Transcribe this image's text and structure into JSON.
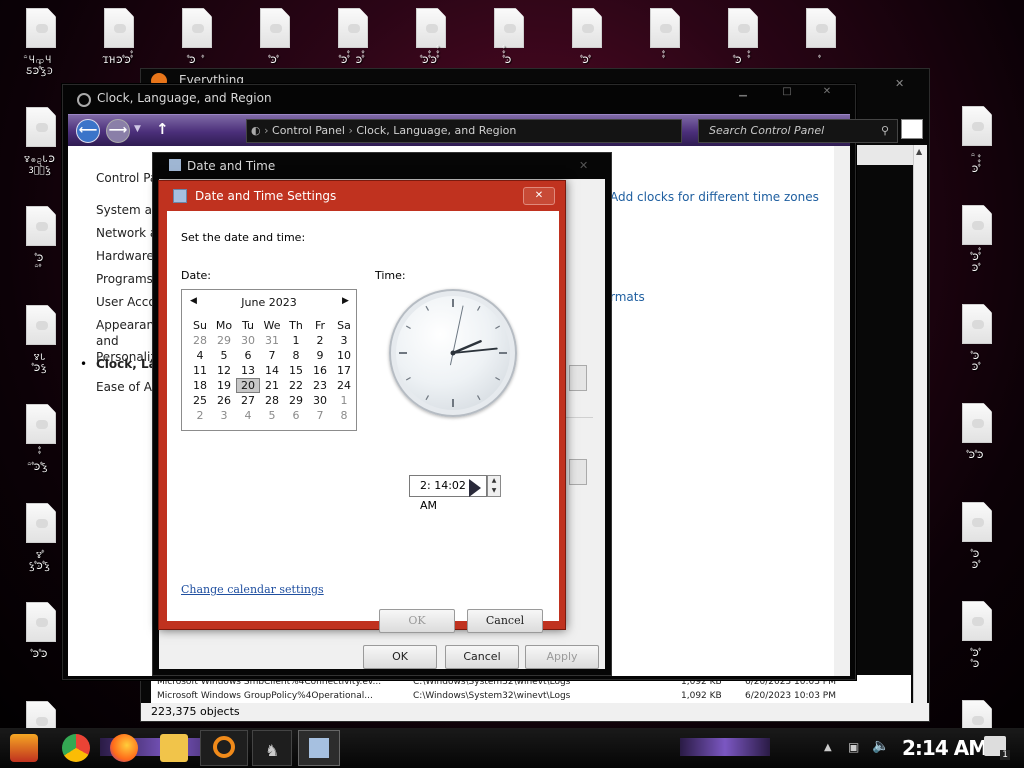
{
  "desktop": {
    "left_icons": [
      "ꩰႷကႷ\nƼꜾꚞꚞꝢꜾ",
      "ꢮၜဍᏓꜾ\nЗꚞꚞꝢ",
      "ꚞꜾ\nꩰꚞ",
      "ꢮᏓ\nꚞꜾꝢ",
      "ꚞꚞ\nꩰꚞꜾꚞꝢ",
      "ꢮꚞ\nꝢꚞꜾꚞꝢ",
      "ꚞꜾꚞꜾ",
      "ꜾꚞꚞꜾ"
    ],
    "top_icons": [
      "ΊΉꜾꚞꜾꚞꚞ",
      "ꚞꜾ ꚞ",
      "ꚞꜾꚞ",
      "ꚞꜾꚞꚞ Ꜿꚞꚞ",
      "ꚞꜾꚞꚞꜾꚞꚞꚞ",
      "ꚞꚞꚞꜾ",
      "ꚞꜾꚞ",
      "ꚞꚞ",
      "ꚞꜾ ꚞꚞ",
      "ꚞ"
    ],
    "right_icons": [
      "ꩰ\nꜾꚞꚞꚞ",
      "ꚞꜾꚞꚞ\nꜾꚞ",
      "ꚞꜾ\nꜾꚞ",
      "ꚞꜾꚞꜾ",
      "ꚞꜾ\nꜾꚞ",
      "ꚞꜾꚞ\nꚞꜾ",
      "ꚞꜾ\nꜾꚞ"
    ]
  },
  "everything_window": {
    "title": "Everything",
    "status": "223,375 objects",
    "rows": [
      {
        "name": "Microsoft Windows SmbClient%4Connectivity.ev...",
        "path": "C:\\Windows\\System32\\winevt\\Logs",
        "size": "1,092 KB",
        "date": "6/20/2023 10:03 PM"
      },
      {
        "name": "Microsoft Windows GroupPolicy%4Operational...",
        "path": "C:\\Windows\\System32\\winevt\\Logs",
        "size": "1,092 KB",
        "date": "6/20/2023 10:03 PM"
      }
    ]
  },
  "control_panel": {
    "title": "Clock, Language, and Region",
    "breadcrumb": [
      "Control Panel",
      "Clock, Language, and Region"
    ],
    "search_placeholder": "Search Control Panel",
    "sidebar": [
      {
        "label": "Control Panel Home",
        "active": false
      },
      {
        "label": "System and Security",
        "active": false
      },
      {
        "label": "Network and Internet",
        "active": false
      },
      {
        "label": "Hardware and Sound",
        "active": false
      },
      {
        "label": "Programs",
        "active": false
      },
      {
        "label": "User Accounts",
        "active": false
      },
      {
        "label": "Appearance and Personalization",
        "active": false
      },
      {
        "label": "Clock, Language, and Region",
        "active": true
      },
      {
        "label": "Ease of Access",
        "active": false
      }
    ],
    "links": {
      "add_clocks": "Add clocks for different time zones",
      "formats": "rmats"
    }
  },
  "date_time_window": {
    "title": "Date and Time",
    "ok": "OK",
    "cancel": "Cancel",
    "apply": "Apply"
  },
  "settings_dialog": {
    "title": "Date and Time Settings",
    "instruction": "Set the date and time:",
    "date_label": "Date:",
    "time_label": "Time:",
    "calendar": {
      "month": "June 2023",
      "days_of_week": [
        "Su",
        "Mo",
        "Tu",
        "We",
        "Th",
        "Fr",
        "Sa"
      ],
      "weeks": [
        [
          "28",
          "29",
          "30",
          "31",
          "1",
          "2",
          "3"
        ],
        [
          "4",
          "5",
          "6",
          "7",
          "8",
          "9",
          "10"
        ],
        [
          "11",
          "12",
          "13",
          "14",
          "15",
          "16",
          "17"
        ],
        [
          "18",
          "19",
          "20",
          "21",
          "22",
          "23",
          "24"
        ],
        [
          "25",
          "26",
          "27",
          "28",
          "29",
          "30",
          "1"
        ],
        [
          "2",
          "3",
          "4",
          "5",
          "6",
          "7",
          "8"
        ]
      ],
      "selected": "20"
    },
    "clock": {
      "hour": 2,
      "minute": 14,
      "second": 2
    },
    "time_value": "2: 14:02 AM",
    "change_calendar": "Change calendar settings",
    "ok": "OK",
    "cancel": "Cancel"
  },
  "taskbar": {
    "clock": "2:14 AM",
    "notification_count": "1"
  },
  "colors": {
    "dialog_frame": "#c0321f",
    "nav_purple": "#4b2f7a",
    "link_blue": "#1f5fa0"
  }
}
